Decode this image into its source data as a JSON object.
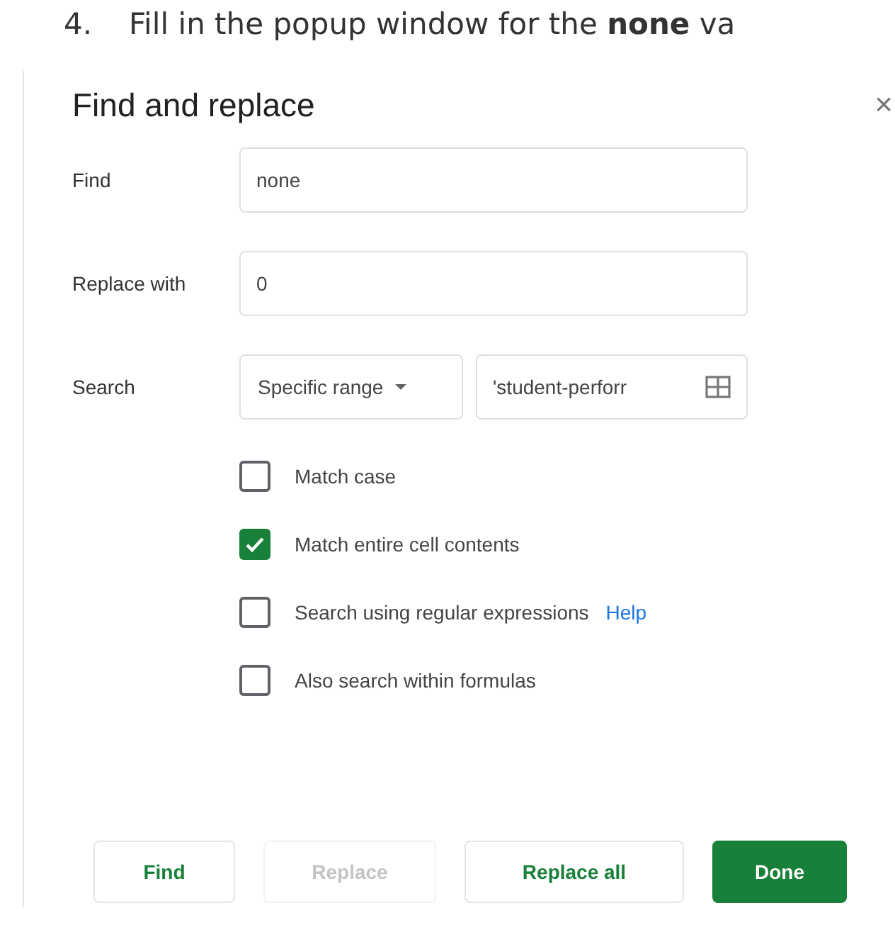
{
  "instruction": {
    "number": "4.",
    "text": "Fill in the popup window for the **none** va"
  },
  "dialog": {
    "title": "Find and replace",
    "close": "×",
    "fields": [
      {
        "label": "Find",
        "value": "none"
      },
      {
        "label": "Replace with",
        "value": "0"
      }
    ],
    "search": {
      "label": "Search",
      "scope": "Specific range",
      "range": "'student-perforr"
    },
    "options": [
      {
        "label": "Match case",
        "checked": false
      },
      {
        "label": "Match entire cell contents",
        "checked": true
      },
      {
        "label": "Search using regular expressions",
        "checked": false,
        "link": "Help"
      },
      {
        "label": "Also search within formulas",
        "checked": false
      }
    ],
    "buttons": [
      {
        "label": "Find",
        "kind": "secondary",
        "disabled": false
      },
      {
        "label": "Replace",
        "kind": "secondary",
        "disabled": true
      },
      {
        "label": "Replace all",
        "kind": "secondary",
        "disabled": false
      },
      {
        "label": "Done",
        "kind": "primary",
        "disabled": false
      }
    ]
  }
}
